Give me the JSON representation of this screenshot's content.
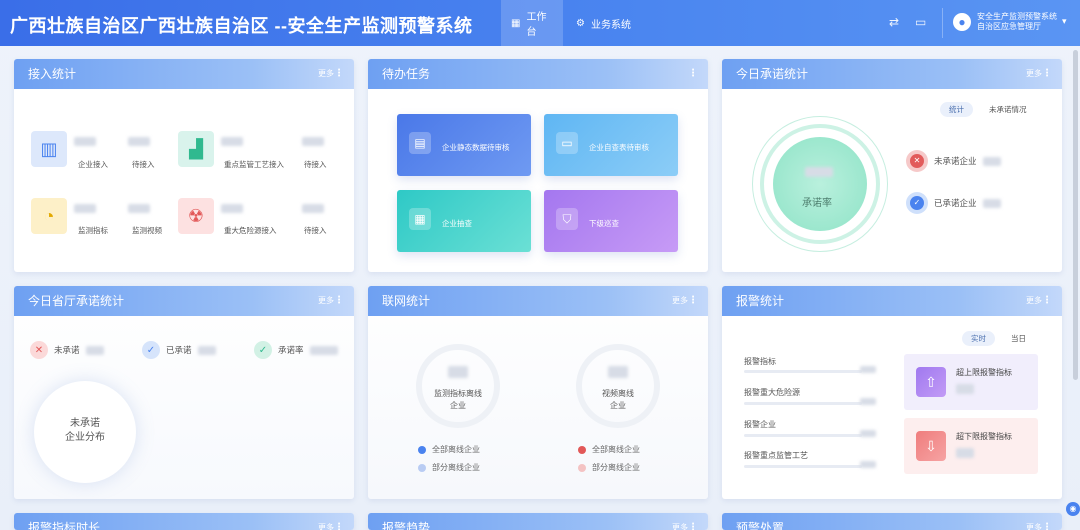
{
  "header": {
    "title": "广西壮族自治区广西壮族自治区 --安全生产监测预警系统",
    "tabs": [
      {
        "label": "工作台",
        "icon": "grid-icon"
      },
      {
        "label": "业务系统",
        "icon": "gear-icon"
      }
    ],
    "user_line1": "安全生产监测预警系统",
    "user_line2": "自治区应急管理厅"
  },
  "common": {
    "more": "更多"
  },
  "access": {
    "title": "接入统计",
    "items": [
      {
        "label": "企业接入",
        "icon": "building-icon"
      },
      {
        "label": "待接入"
      },
      {
        "label": "重点监管工艺接入",
        "icon": "factory-icon"
      },
      {
        "label": "待接入"
      },
      {
        "label": "监测指标",
        "icon": "gauge-icon"
      },
      {
        "label": "监测视频"
      },
      {
        "label": "重大危险源接入",
        "icon": "hazard-icon"
      },
      {
        "label": "待接入"
      }
    ]
  },
  "todo": {
    "title": "待办任务",
    "tiles": [
      {
        "label": "企业静态数据待审核",
        "icon": "doc-icon"
      },
      {
        "label": "企业自查表待审核",
        "icon": "chart-icon"
      },
      {
        "label": "企业抽查",
        "icon": "file-icon"
      },
      {
        "label": "下级巡查",
        "icon": "shield-icon"
      }
    ]
  },
  "commit": {
    "title": "今日承诺统计",
    "pills": [
      "统计",
      "未承诺情况"
    ],
    "center_label": "承诺率",
    "rows": [
      {
        "label": "未承诺企业"
      },
      {
        "label": "已承诺企业"
      }
    ]
  },
  "dept": {
    "title": "今日省厅承诺统计",
    "stats": [
      {
        "label": "未承诺"
      },
      {
        "label": "已承诺"
      },
      {
        "label": "承诺率"
      }
    ],
    "circle_line1": "未承诺",
    "circle_line2": "企业分布"
  },
  "network": {
    "title": "联网统计",
    "left_label_1": "监测指标离线",
    "left_label_2": "企业",
    "right_label_1": "视频离线",
    "right_label_2": "企业",
    "left_legend": [
      "全部离线企业",
      "部分离线企业"
    ],
    "right_legend": [
      "全部离线企业",
      "部分离线企业"
    ]
  },
  "alarm": {
    "title": "报警统计",
    "pills": [
      "实时",
      "当日"
    ],
    "rows": [
      "报警指标",
      "报警重大危险源",
      "报警企业",
      "报警重点监管工艺"
    ],
    "cards": [
      {
        "label": "超上限报警指标",
        "icon": "arrow-up-icon"
      },
      {
        "label": "超下限报警指标",
        "icon": "arrow-down-icon"
      }
    ]
  },
  "bottom": {
    "titles": [
      "报警指标时长",
      "报警趋势",
      "预警处置"
    ]
  },
  "colors": {
    "accent": "#4a83ef",
    "header": "#3a6ee8"
  }
}
